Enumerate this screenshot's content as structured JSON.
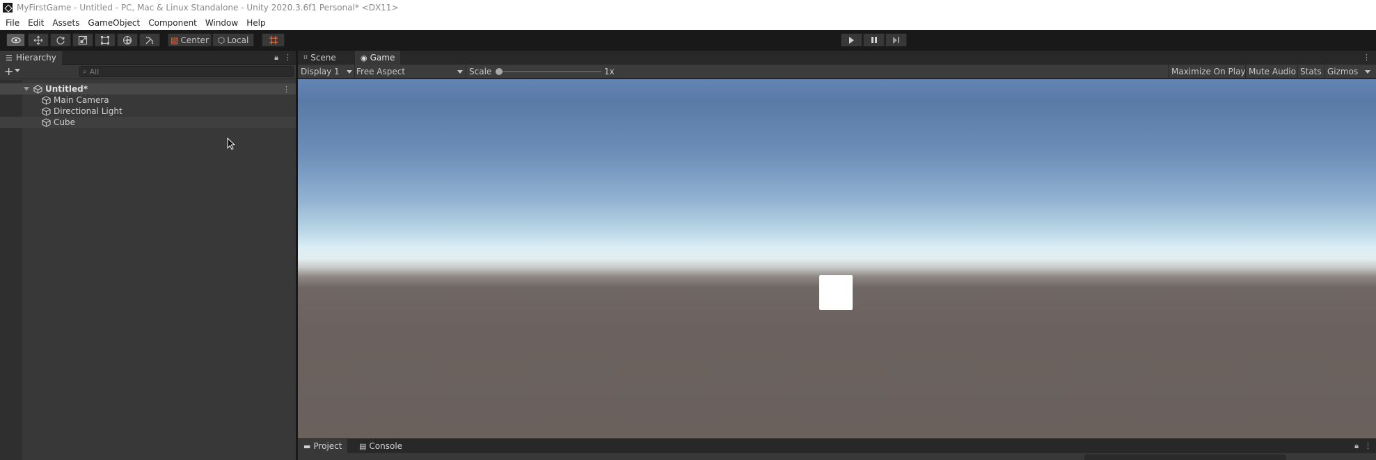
{
  "window": {
    "title": "MyFirstGame - Untitled - PC, Mac & Linux Standalone - Unity 2020.3.6f1 Personal* <DX11>"
  },
  "menu": [
    "File",
    "Edit",
    "Assets",
    "GameObject",
    "Component",
    "Window",
    "Help"
  ],
  "toolbar": {
    "tools": [
      "view-tool",
      "move-tool",
      "rotate-tool",
      "scale-tool",
      "rect-tool",
      "transform-tool",
      "custom-tool"
    ],
    "active_tool": "view-tool",
    "pivot_mode": "Center",
    "pivot_rotation": "Local",
    "playback": [
      "play",
      "pause",
      "step"
    ]
  },
  "hierarchy": {
    "tab_label": "Hierarchy",
    "search_placeholder": "All",
    "scene_name": "Untitled*",
    "items": [
      {
        "label": "Main Camera"
      },
      {
        "label": "Directional Light"
      },
      {
        "label": "Cube"
      }
    ]
  },
  "center_panel": {
    "tabs": [
      {
        "label": "Scene",
        "active": false
      },
      {
        "label": "Game",
        "active": true
      }
    ],
    "game_toolbar": {
      "display": "Display 1",
      "aspect": "Free Aspect",
      "scale_label": "Scale",
      "scale_value": "1x",
      "scale_fraction": 0.0,
      "maximize_on_play": "Maximize On Play",
      "mute_audio": "Mute Audio",
      "stats": "Stats",
      "gizmos": "Gizmos"
    }
  },
  "bottom_panel": {
    "tabs": [
      {
        "label": "Project",
        "active": true
      },
      {
        "label": "Console",
        "active": false
      }
    ]
  },
  "colors": {
    "accent_orange": "#ee6a3b",
    "sky_top": "#6285b4",
    "horizon": "#e3eef0",
    "ground": "#6a615d"
  }
}
